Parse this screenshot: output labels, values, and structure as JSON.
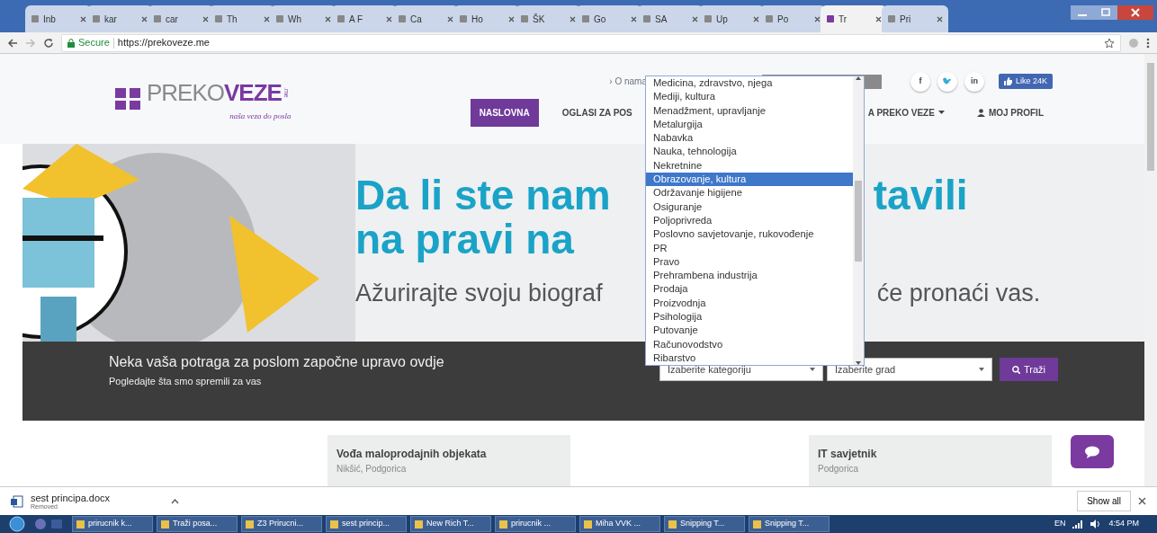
{
  "browser": {
    "tabs": [
      {
        "label": "Inb",
        "selected": false
      },
      {
        "label": "kar",
        "selected": false
      },
      {
        "label": "car",
        "selected": false
      },
      {
        "label": "Th",
        "selected": false
      },
      {
        "label": "Wh",
        "selected": false
      },
      {
        "label": "A F",
        "selected": false
      },
      {
        "label": "Ca",
        "selected": false
      },
      {
        "label": "Ho",
        "selected": false
      },
      {
        "label": "ŠK",
        "selected": false
      },
      {
        "label": "Go",
        "selected": false
      },
      {
        "label": "SA",
        "selected": false
      },
      {
        "label": "Up",
        "selected": false
      },
      {
        "label": "Po",
        "selected": false
      },
      {
        "label": "Tr",
        "selected": true
      },
      {
        "label": "Pri",
        "selected": false
      }
    ],
    "secure_label": "Secure",
    "url": "https://prekoveze.me"
  },
  "header": {
    "logo": {
      "part_1": "PREKO",
      "part_2": "VEZE",
      "suffix": ".me",
      "tagline": "naša veza do posla"
    },
    "top_link": "› O nama",
    "social": [
      "f",
      "🐦",
      "in"
    ],
    "like": "Like 24K",
    "nav": [
      {
        "label": "NASLOVNA",
        "selected": true,
        "caret": false,
        "kind": "text"
      },
      {
        "label": "OGLASI ZA POS",
        "selected": false,
        "caret": false,
        "kind": "text"
      },
      {
        "label": "A PREKO VEZE",
        "selected": false,
        "caret": true,
        "kind": "text"
      },
      {
        "label": "MOJ PROFIL",
        "selected": false,
        "caret": false,
        "kind": "user"
      }
    ]
  },
  "hero": {
    "line_1_left": "Da li ste nam",
    "line_1_right": "tavili",
    "line_2": "na pravi na",
    "line_3_left": "Ažurirajte svoju biograf",
    "line_3_right": "će pronaći vas."
  },
  "category_list": [
    {
      "label": "Medicina, zdravstvo, njega",
      "selected": false
    },
    {
      "label": "Mediji, kultura",
      "selected": false
    },
    {
      "label": "Menadžment, upravljanje",
      "selected": false
    },
    {
      "label": "Metalurgija",
      "selected": false
    },
    {
      "label": "Nabavka",
      "selected": false
    },
    {
      "label": "Nauka, tehnologija",
      "selected": false
    },
    {
      "label": "Nekretnine",
      "selected": false
    },
    {
      "label": "Obrazovanje, kultura",
      "selected": true
    },
    {
      "label": "Održavanje higijene",
      "selected": false
    },
    {
      "label": "Osiguranje",
      "selected": false
    },
    {
      "label": "Poljoprivreda",
      "selected": false
    },
    {
      "label": "Poslovno savjetovanje, rukovođenje",
      "selected": false
    },
    {
      "label": "PR",
      "selected": false
    },
    {
      "label": "Pravo",
      "selected": false
    },
    {
      "label": "Prehrambena industrija",
      "selected": false
    },
    {
      "label": "Prodaja",
      "selected": false
    },
    {
      "label": "Proizvodnja",
      "selected": false
    },
    {
      "label": "Psihologija",
      "selected": false
    },
    {
      "label": "Putovanje",
      "selected": false
    },
    {
      "label": "Računovodstvo",
      "selected": false
    },
    {
      "label": "Ribarstvo",
      "selected": false
    }
  ],
  "search_band": {
    "headline": "Neka vaša potraga za poslom započne upravo ovdje",
    "subline": "Pogledajte šta smo spremili za vas",
    "category_select": "Izaberite kategoriju",
    "city_select": "Izaberite grad",
    "search_button": "Traži"
  },
  "jobs": [
    {
      "title": "Vođa maloprodajnih objekata",
      "location": "Nikšić, Podgorica"
    },
    {
      "title": "IT savjetnik",
      "location": "Podgorica"
    }
  ],
  "download_bar": {
    "file": "sest principa.docx",
    "status": "Removed",
    "show_all": "Show all"
  },
  "taskbar": {
    "items": [
      "prirucnik k...",
      "Traži posa...",
      "Z3 Prirucni...",
      "sest princip...",
      "New Rich T...",
      "prirucnik ...",
      "Miha VVK ...",
      "Snipping T...",
      "Snipping T..."
    ],
    "language": "EN",
    "time": "4:54 PM"
  }
}
